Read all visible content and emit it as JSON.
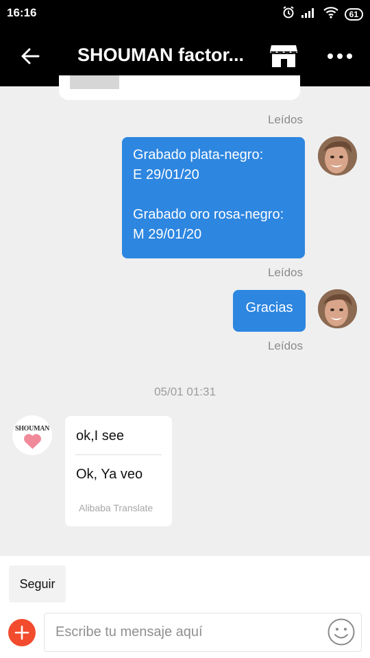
{
  "status_bar": {
    "time": "16:16",
    "battery": "61"
  },
  "header": {
    "title": "SHOUMAN factor..."
  },
  "messages": {
    "read_label": "Leídos",
    "outgoing_1": {
      "line1": "Grabado plata-negro:",
      "line2": "E 29/01/20",
      "line3": "Grabado oro rosa-negro:",
      "line4": "M 29/01/20"
    },
    "outgoing_2": {
      "text": "Gracias"
    },
    "timestamp": "05/01 01:31",
    "incoming": {
      "original": "ok,I see",
      "translated": "Ok, Ya veo",
      "translate_label": "Alibaba Translate",
      "shop_logo_text": "SHOUMAN"
    }
  },
  "bottom": {
    "follow_label": "Seguir",
    "input_placeholder": "Escribe tu mensaje aquí"
  },
  "colors": {
    "accent_blue": "#2d86e0",
    "add_button": "#f24b2e",
    "background": "#efefef"
  }
}
